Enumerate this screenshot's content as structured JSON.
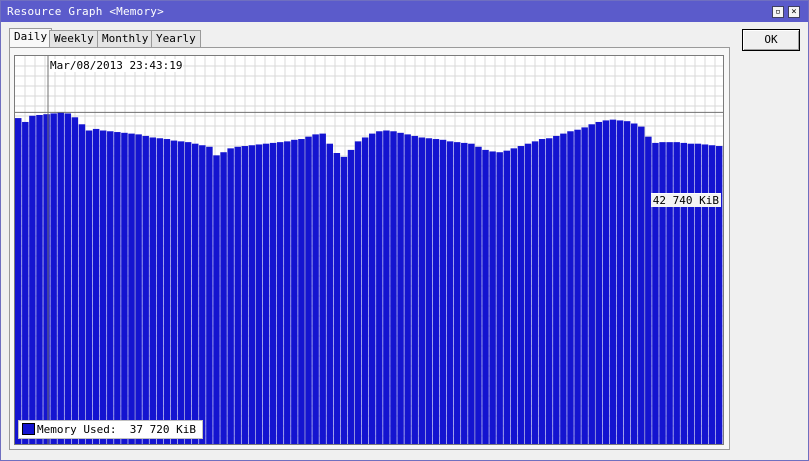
{
  "window": {
    "title": "Resource Graph <Memory>",
    "maximize_icon": "maximize-icon",
    "close_icon": "close-icon"
  },
  "tabs": [
    {
      "label": "Daily",
      "active": true
    },
    {
      "label": "Weekly",
      "active": false
    },
    {
      "label": "Monthly",
      "active": false
    },
    {
      "label": "Yearly",
      "active": false
    }
  ],
  "ok_button": {
    "label": "OK"
  },
  "graph": {
    "cursor_timestamp": "Mar/08/2013 23:43:19",
    "max_label": "42 740 KiB",
    "legend_label": "Memory Used:",
    "legend_value": "37 720 KiB",
    "series_color": "#1414d0"
  },
  "chart_data": {
    "type": "bar",
    "series": [
      {
        "name": "Memory Used",
        "values": [
          42000,
          41500,
          42300,
          42400,
          42500,
          42600,
          42740,
          42600,
          42100,
          41200,
          40400,
          40600,
          40400,
          40300,
          40200,
          40100,
          40000,
          39900,
          39700,
          39500,
          39400,
          39300,
          39100,
          39000,
          38900,
          38700,
          38500,
          38300,
          37200,
          37600,
          38100,
          38300,
          38400,
          38500,
          38600,
          38700,
          38800,
          38900,
          39000,
          39200,
          39300,
          39600,
          39900,
          40000,
          38700,
          37500,
          37000,
          37900,
          39000,
          39500,
          40000,
          40300,
          40400,
          40300,
          40100,
          39900,
          39700,
          39500,
          39400,
          39300,
          39200,
          39000,
          38900,
          38800,
          38700,
          38300,
          37900,
          37700,
          37600,
          37800,
          38100,
          38400,
          38700,
          39000,
          39300,
          39400,
          39700,
          40000,
          40300,
          40500,
          40800,
          41200,
          41500,
          41700,
          41800,
          41700,
          41600,
          41300,
          40900,
          39600,
          38800,
          38900,
          38900,
          38900,
          38800,
          38700,
          38700,
          38600,
          38500,
          38400
        ]
      }
    ],
    "ylim": [
      0,
      50000
    ],
    "grid": true,
    "legend": "bottom-left"
  }
}
